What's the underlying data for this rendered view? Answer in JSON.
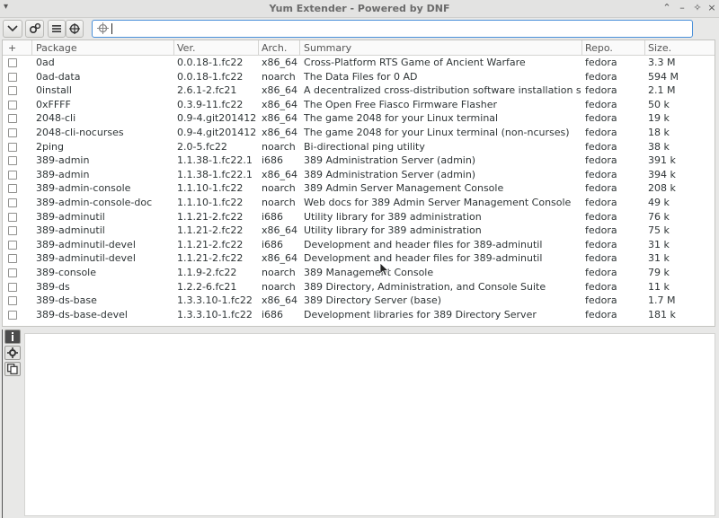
{
  "window": {
    "title": "Yum Extender - Powered by DNF"
  },
  "toolbar": {
    "search_value": ""
  },
  "table": {
    "columns": {
      "select": "+",
      "package": "Package",
      "version": "Ver.",
      "arch": "Arch.",
      "summary": "Summary",
      "repo": "Repo.",
      "size": "Size."
    },
    "rows": [
      {
        "name": "0ad",
        "ver": "0.0.18-1.fc22",
        "arch": "x86_64",
        "summary": "Cross-Platform RTS Game of Ancient Warfare",
        "repo": "fedora",
        "size": "3.3 M"
      },
      {
        "name": "0ad-data",
        "ver": "0.0.18-1.fc22",
        "arch": "noarch",
        "summary": "The Data Files for 0 AD",
        "repo": "fedora",
        "size": "594 M"
      },
      {
        "name": "0install",
        "ver": "2.6.1-2.fc21",
        "arch": "x86_64",
        "summary": "A decentralized cross-distribution software installation system",
        "repo": "fedora",
        "size": "2.1 M"
      },
      {
        "name": "0xFFFF",
        "ver": "0.3.9-11.fc22",
        "arch": "x86_64",
        "summary": "The Open Free Fiasco Firmware Flasher",
        "repo": "fedora",
        "size": "50 k"
      },
      {
        "name": "2048-cli",
        "ver": "0.9-4.git20141214",
        "arch": "x86_64",
        "summary": "The game 2048 for your Linux terminal",
        "repo": "fedora",
        "size": "19 k"
      },
      {
        "name": "2048-cli-nocurses",
        "ver": "0.9-4.git20141214",
        "arch": "x86_64",
        "summary": "The game 2048 for your Linux terminal (non-ncurses)",
        "repo": "fedora",
        "size": "18 k"
      },
      {
        "name": "2ping",
        "ver": "2.0-5.fc22",
        "arch": "noarch",
        "summary": "Bi-directional ping utility",
        "repo": "fedora",
        "size": "38 k"
      },
      {
        "name": "389-admin",
        "ver": "1.1.38-1.fc22.1",
        "arch": "i686",
        "summary": "389 Administration Server (admin)",
        "repo": "fedora",
        "size": "391 k"
      },
      {
        "name": "389-admin",
        "ver": "1.1.38-1.fc22.1",
        "arch": "x86_64",
        "summary": "389 Administration Server (admin)",
        "repo": "fedora",
        "size": "394 k"
      },
      {
        "name": "389-admin-console",
        "ver": "1.1.10-1.fc22",
        "arch": "noarch",
        "summary": "389 Admin Server Management Console",
        "repo": "fedora",
        "size": "208 k"
      },
      {
        "name": "389-admin-console-doc",
        "ver": "1.1.10-1.fc22",
        "arch": "noarch",
        "summary": "Web docs for 389 Admin Server Management Console",
        "repo": "fedora",
        "size": "49 k"
      },
      {
        "name": "389-adminutil",
        "ver": "1.1.21-2.fc22",
        "arch": "i686",
        "summary": "Utility library for 389 administration",
        "repo": "fedora",
        "size": "76 k"
      },
      {
        "name": "389-adminutil",
        "ver": "1.1.21-2.fc22",
        "arch": "x86_64",
        "summary": "Utility library for 389 administration",
        "repo": "fedora",
        "size": "75 k"
      },
      {
        "name": "389-adminutil-devel",
        "ver": "1.1.21-2.fc22",
        "arch": "i686",
        "summary": "Development and header files for 389-adminutil",
        "repo": "fedora",
        "size": "31 k"
      },
      {
        "name": "389-adminutil-devel",
        "ver": "1.1.21-2.fc22",
        "arch": "x86_64",
        "summary": "Development and header files for 389-adminutil",
        "repo": "fedora",
        "size": "31 k"
      },
      {
        "name": "389-console",
        "ver": "1.1.9-2.fc22",
        "arch": "noarch",
        "summary": "389 Management Console",
        "repo": "fedora",
        "size": "79 k"
      },
      {
        "name": "389-ds",
        "ver": "1.2.2-6.fc21",
        "arch": "noarch",
        "summary": "389 Directory, Administration, and Console Suite",
        "repo": "fedora",
        "size": "11 k"
      },
      {
        "name": "389-ds-base",
        "ver": "1.3.3.10-1.fc22",
        "arch": "x86_64",
        "summary": "389 Directory Server (base)",
        "repo": "fedora",
        "size": "1.7 M"
      },
      {
        "name": "389-ds-base-devel",
        "ver": "1.3.3.10-1.fc22",
        "arch": "i686",
        "summary": "Development libraries for 389 Directory Server",
        "repo": "fedora",
        "size": "181 k"
      }
    ]
  },
  "icons": {
    "menu": "chevron-down-icon",
    "toolbar": [
      "dropdown-arrow-icon",
      "gears-icon",
      "list-icon",
      "target-icon"
    ],
    "window": [
      "window-menu-icon",
      "maximize-up-icon",
      "minimize-icon",
      "restore-icon",
      "close-icon"
    ],
    "sidetabs": [
      "info-icon",
      "gear-icon",
      "copy-icon"
    ]
  }
}
